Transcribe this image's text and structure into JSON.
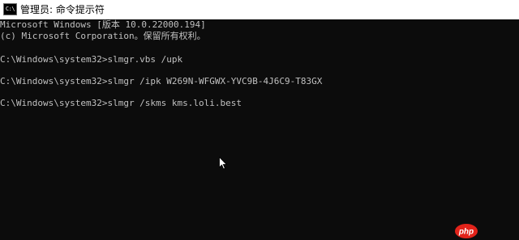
{
  "window": {
    "title": "管理员: 命令提示符",
    "icon_label": "C:\\",
    "icon_name": "cmd-icon"
  },
  "console": {
    "lines": [
      "Microsoft Windows [版本 10.0.22000.194]",
      "(c) Microsoft Corporation。保留所有权利。",
      "C:\\Windows\\system32>slmgr.vbs /upk",
      "C:\\Windows\\system32>slmgr /ipk W269N-WFGWX-YVC9B-4J6C9-T83GX",
      "C:\\Windows\\system32>slmgr /skms kms.loli.best"
    ]
  },
  "watermark": {
    "text": "php"
  },
  "colors": {
    "background": "#0c0c0c",
    "text": "#c0c0c0",
    "titlebar": "#ffffff",
    "watermark_red": "#e2231a"
  }
}
